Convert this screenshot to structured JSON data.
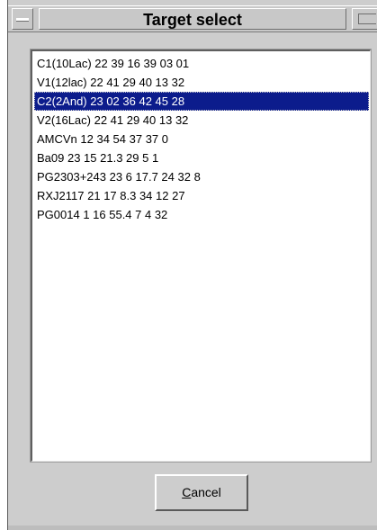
{
  "window": {
    "title": "Target select"
  },
  "list": {
    "items": [
      "C1(10Lac) 22 39 16 39 03 01",
      "V1(12lac) 22 41 29 40 13 32",
      "C2(2And)  23 02 36 42 45 28",
      "V2(16Lac) 22 41 29 40 13 32",
      "AMCVn 12 34 54 37 37 0",
      "Ba09 23 15 21.3 29 5 1",
      "PG2303+243 23 6 17.7 24 32 8",
      "RXJ2117 21 17 8.3 34 12 27",
      "PG0014 1 16 55.4 7 4 32"
    ],
    "selected_index": 2
  },
  "buttons": {
    "cancel_mnemonic": "C",
    "cancel_rest": "ancel"
  },
  "colors": {
    "selection_bg": "#0c1c8c",
    "selection_fg": "#ffffff",
    "window_bg": "#cdcdcd"
  }
}
